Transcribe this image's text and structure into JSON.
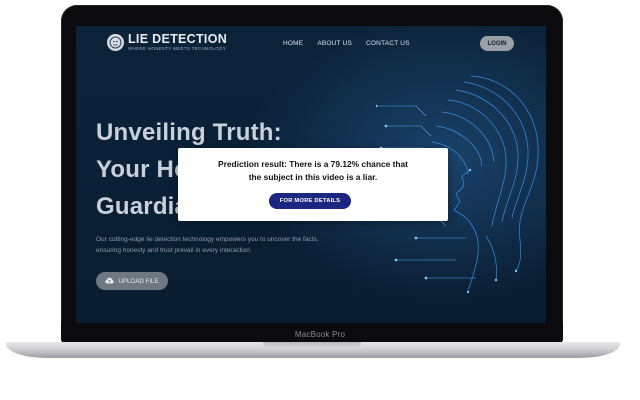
{
  "device": {
    "model_label": "MacBook Pro"
  },
  "brand": {
    "title": "LIE DETECTION",
    "tagline": "WHERE HONESTY MEETS TECHNOLOGY"
  },
  "nav": {
    "items": [
      {
        "label": "HOME"
      },
      {
        "label": "ABOUT US"
      },
      {
        "label": "CONTACT US"
      }
    ],
    "login_label": "LOGIN"
  },
  "hero": {
    "headline_line1": "Unveiling Truth:",
    "headline_line2": "Your Ho",
    "headline_line3": "Guardia",
    "description": "Our cutting-edge lie detection technology empowers you to uncover the facts, ensuring honesty and trust prevail in every interaction.",
    "upload_label": "UPLOAD FILE",
    "upload_icon": "cloud-upload-icon"
  },
  "modal": {
    "result_line1": "Prediction result: There is a 79.12% chance that",
    "result_line2": "the subject in this video is a liar.",
    "button_label": "FOR MORE DETAILS"
  },
  "colors": {
    "background": "#0a2036",
    "accent_button": "#1c2680",
    "circuit": "#3aa0ff"
  }
}
